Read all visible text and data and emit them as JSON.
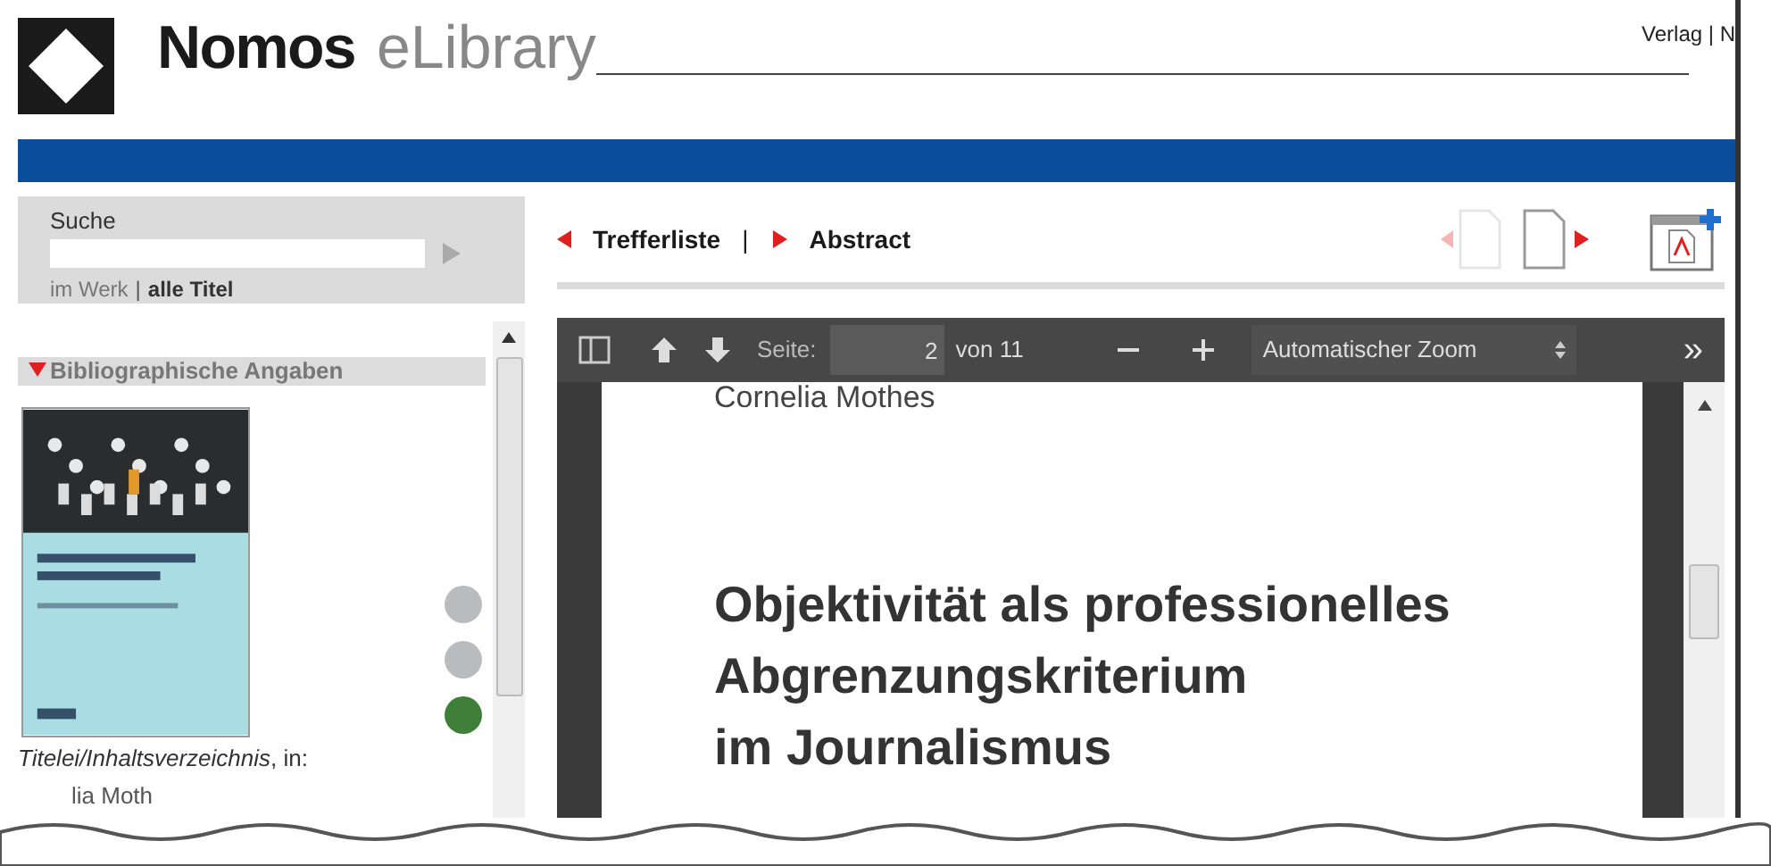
{
  "header": {
    "brand_bold": "Nomos",
    "brand_light": "eLibrary",
    "top_links": "Verlag | N"
  },
  "search": {
    "label": "Suche",
    "scope_options": [
      {
        "label": "im Werk",
        "selected": false
      },
      {
        "label": "alle Titel",
        "selected": true
      }
    ],
    "separator": "|"
  },
  "sidebar": {
    "section": {
      "title": "Bibliographische Angaben",
      "expanded": true
    },
    "dots": [
      {
        "color": "#b9bcbf"
      },
      {
        "color": "#b9bcbf"
      },
      {
        "color": "#3f7f3a"
      }
    ],
    "citation": "*Titelei/Inhaltsverzeichnis*, in:",
    "author_partial": "lia Moth"
  },
  "nav": {
    "links": [
      {
        "label": "Trefferliste",
        "kind": "back"
      },
      {
        "label": "Abstract",
        "kind": "forward"
      }
    ],
    "separator": "|",
    "prev_page": {
      "disabled": true
    },
    "next_page": {
      "disabled": false
    }
  },
  "viewer": {
    "toolbar": {
      "page_label": "Seite:",
      "page_value": "2",
      "page_count": "von 11",
      "zoom": "Automatischer Zoom",
      "more": "»"
    },
    "page": {
      "author": "Cornelia Mothes",
      "title_lines": [
        "Objektivität als professionelles",
        "Abgrenzungskriterium",
        "im Journalismus"
      ]
    }
  }
}
